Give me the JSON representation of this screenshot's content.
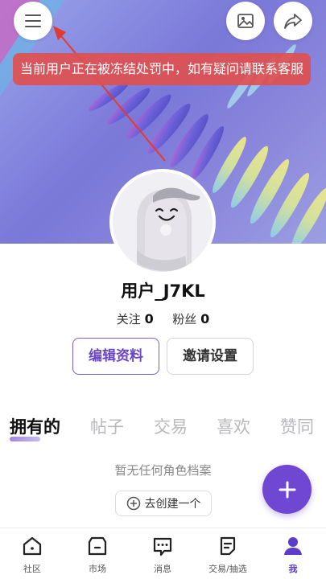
{
  "toast": "当前用户正在被冻结处罚中，如有疑问请联系客服",
  "profile": {
    "username": "用户_J7KL",
    "following_label": "关注",
    "following_count": "0",
    "followers_label": "粉丝",
    "followers_count": "0"
  },
  "actions": {
    "edit_label": "编辑资料",
    "invite_label": "邀请设置"
  },
  "tabs": [
    "拥有的",
    "帖子",
    "交易",
    "喜欢",
    "赞同"
  ],
  "empty": {
    "message": "暂无任何角色档案",
    "create_label": "去创建一个"
  },
  "nav": [
    {
      "label": "社区",
      "icon": "home-icon"
    },
    {
      "label": "市场",
      "icon": "market-icon"
    },
    {
      "label": "消息",
      "icon": "message-icon"
    },
    {
      "label": "交易/抽选",
      "icon": "trade-icon"
    },
    {
      "label": "我",
      "icon": "user-icon"
    }
  ],
  "colors": {
    "accent": "#6f47d3",
    "toast": "#de5050"
  }
}
